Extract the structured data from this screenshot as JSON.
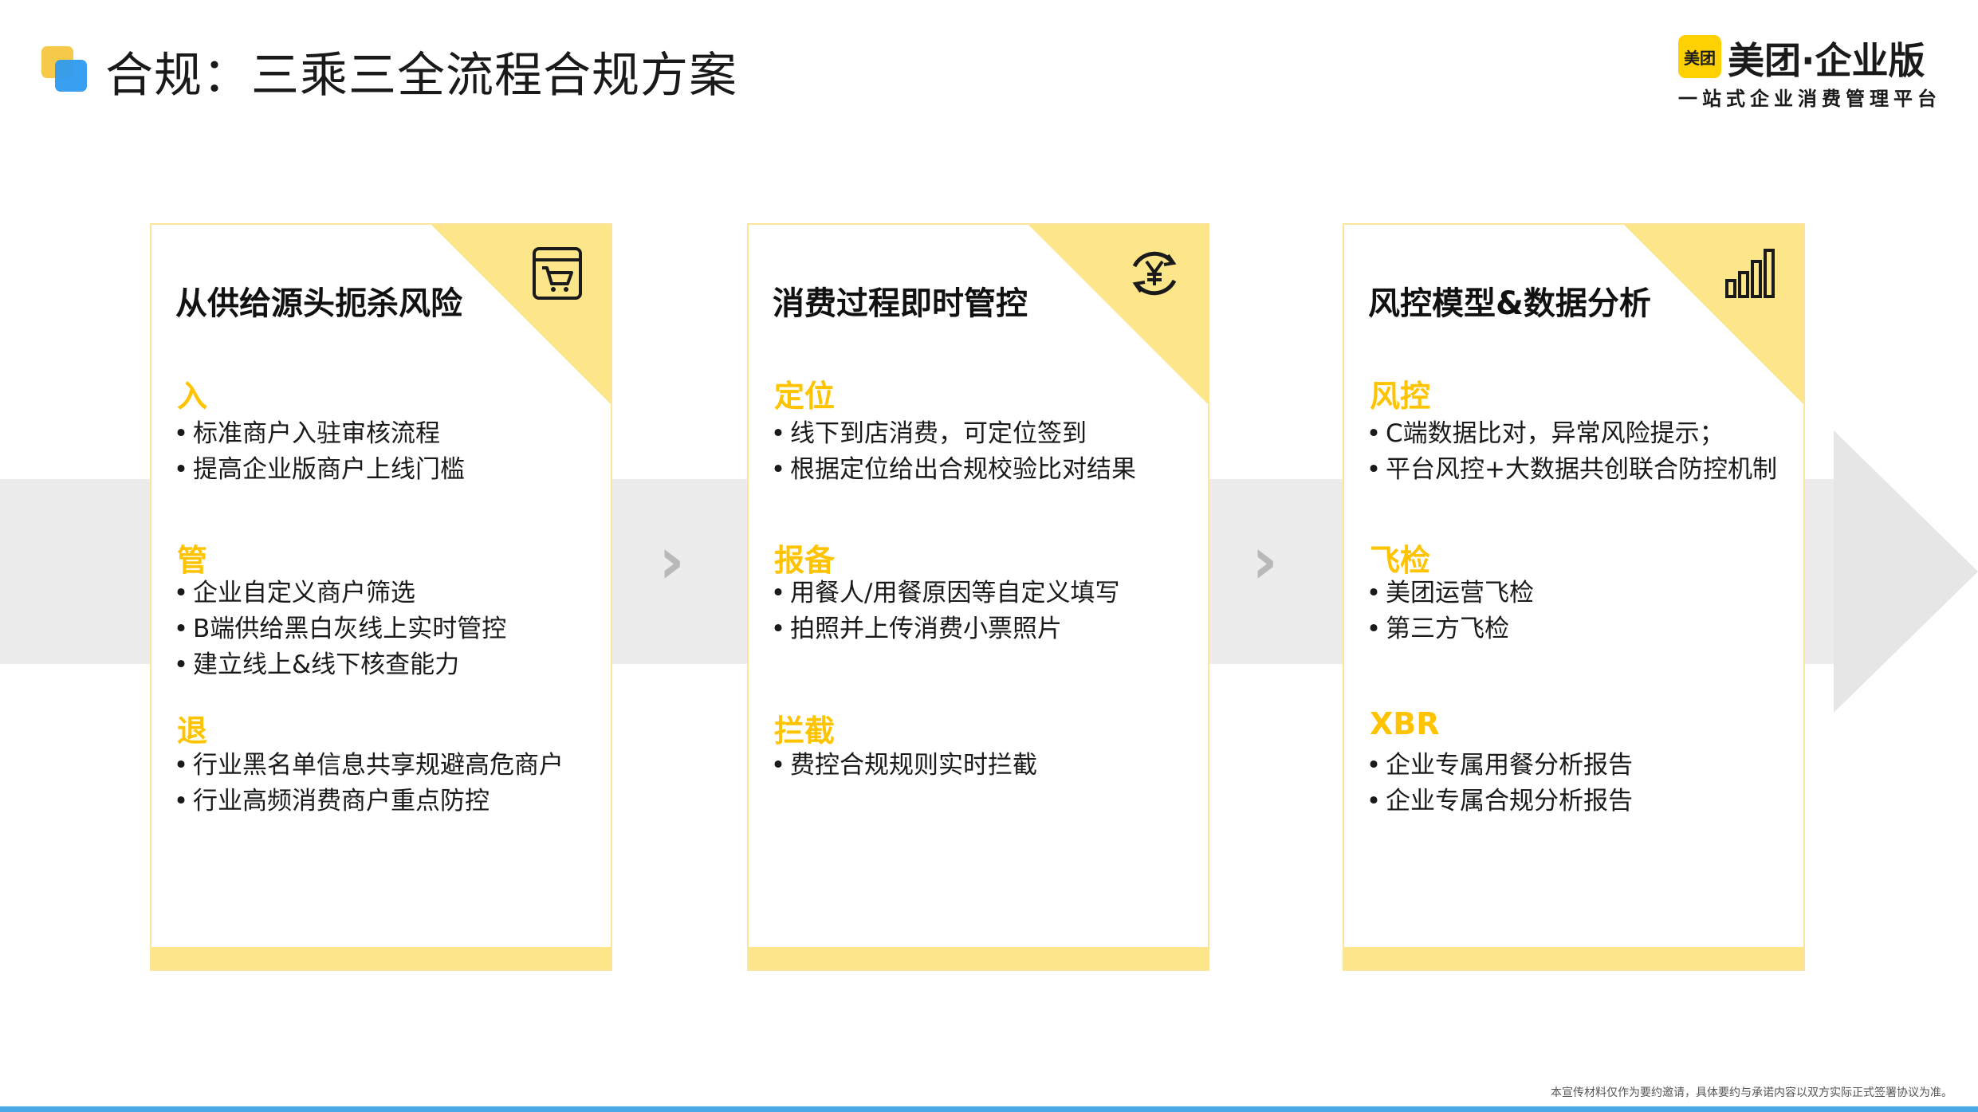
{
  "header": {
    "title": "合规：三乘三全流程合规方案",
    "brand_badge": "美团",
    "brand_name": "美团·企业版",
    "brand_tagline": "一站式企业消费管理平台"
  },
  "cards": [
    {
      "title": "从供给源头扼杀风险",
      "icon": "shopping-cart-icon",
      "sections": [
        {
          "head": "入",
          "items": [
            "标准商户入驻审核流程",
            "提高企业版商户上线门槛"
          ]
        },
        {
          "head": "管",
          "items": [
            "企业自定义商户筛选",
            "B端供给黑白灰线上实时管控",
            "建立线上&线下核查能力"
          ]
        },
        {
          "head": "退",
          "items": [
            "行业黑名单信息共享规避高危商户",
            "行业高频消费商户重点防控"
          ]
        }
      ]
    },
    {
      "title": "消费过程即时管控",
      "icon": "yuan-refresh-icon",
      "sections": [
        {
          "head": "定位",
          "items": [
            "线下到店消费，可定位签到",
            "根据定位给出合规校验比对结果"
          ]
        },
        {
          "head": "报备",
          "items": [
            "用餐人/用餐原因等自定义填写",
            "拍照并上传消费小票照片"
          ]
        },
        {
          "head": "拦截",
          "items": [
            "费控合规规则实时拦截"
          ]
        }
      ]
    },
    {
      "title": "风控模型&数据分析",
      "icon": "bar-chart-icon",
      "sections": [
        {
          "head": "风控",
          "items": [
            "C端数据比对，异常风险提示；",
            "平台风控+大数据共创联合防控机制"
          ]
        },
        {
          "head": "飞检",
          "items": [
            "美团运营飞检",
            "第三方飞检"
          ]
        },
        {
          "head": "XBR",
          "items": [
            "企业专属用餐分析报告",
            "企业专属合规分析报告"
          ]
        }
      ]
    }
  ],
  "disclaimer": "本宣传材料仅作为要约邀请，具体要约与承诺内容以双方实际正式签署协议为准。",
  "colors": {
    "accent_yellow": "#ffc300",
    "corner_yellow": "#fde68a",
    "band_gray": "#ececec",
    "bottom_blue": "#4aa8e8"
  }
}
